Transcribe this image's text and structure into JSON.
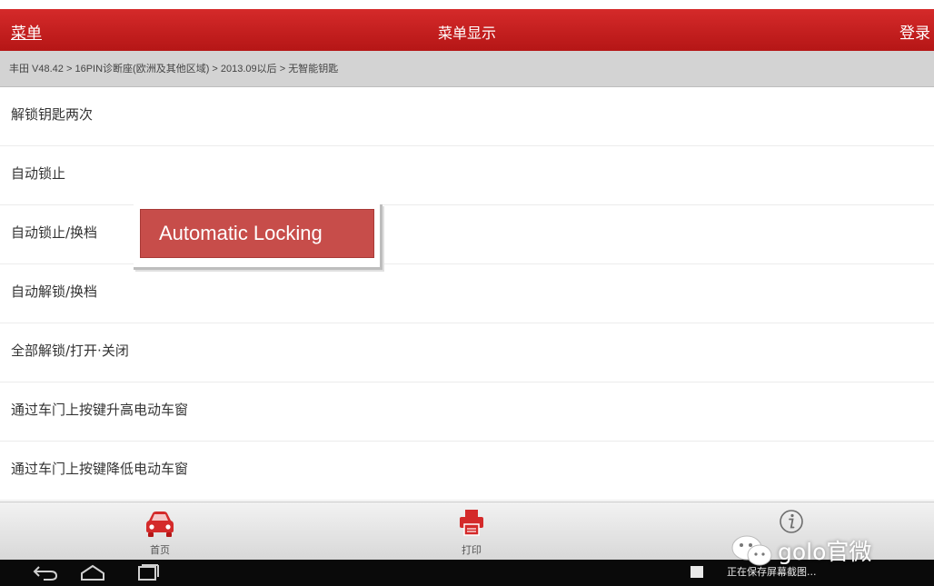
{
  "header": {
    "menu_label": "菜单",
    "title": "菜单显示",
    "login_label": "登录"
  },
  "breadcrumb": "丰田 V48.42 > 16PIN诊断座(欧洲及其他区域) > 2013.09以后 > 无智能钥匙",
  "menu_items": [
    {
      "label": "解锁钥匙两次"
    },
    {
      "label": "自动锁止"
    },
    {
      "label": "自动锁止/换档"
    },
    {
      "label": "自动解锁/换档"
    },
    {
      "label": "全部解锁/打开·关闭"
    },
    {
      "label": "通过车门上按键升高电动车窗"
    },
    {
      "label": "通过车门上按键降低电动车窗"
    }
  ],
  "callout": {
    "text": "Automatic Locking"
  },
  "toolbar": {
    "home_label": "首页",
    "print_label": "打印",
    "info_icon": "info-icon",
    "accent_color": "#d42a2a"
  },
  "system_nav": {
    "back_icon": "back-icon",
    "home_icon": "home-icon",
    "recents_icon": "recents-icon",
    "notification_text": "正在保存屏幕截图..."
  },
  "watermark": {
    "text": "golo官微"
  }
}
